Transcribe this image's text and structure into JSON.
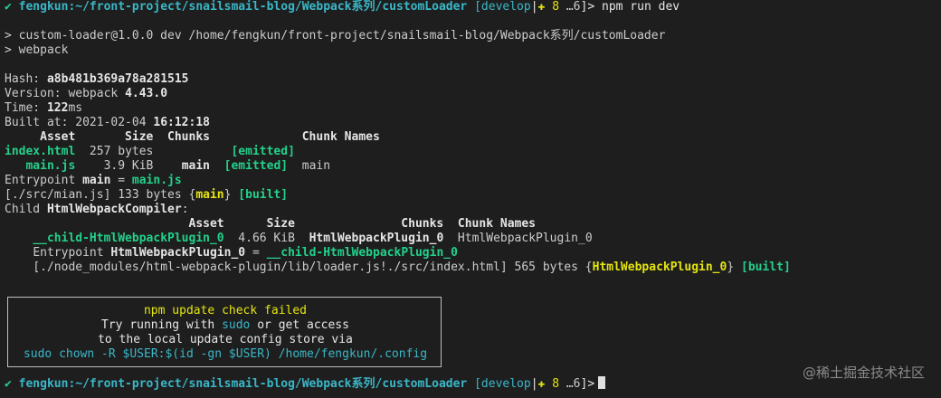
{
  "prompt": {
    "check": "✔",
    "path": "fengkun:~/front-project/snailsmail-blog/Webpack系列/customLoader",
    "branch_open": "[",
    "branch": "develop",
    "sep": "|",
    "plus": "✚ 8",
    "ellipsis": "…6",
    "close": "]>",
    "command": "npm run dev"
  },
  "script_header": {
    "line1": "> custom-loader@1.0.0 dev /home/fengkun/front-project/snailsmail-blog/Webpack系列/customLoader",
    "line2": "> webpack"
  },
  "build": {
    "hash_label": "Hash: ",
    "hash": "a8b481b369a78a281515",
    "version_label": "Version: webpack ",
    "version": "4.43.0",
    "time_label": "Time: ",
    "time": "122",
    "time_unit": "ms",
    "built_label": "Built at: 2021-02-04 ",
    "built_time": "16:12:18"
  },
  "assets_table": {
    "header": "     Asset       Size  Chunks             Chunk Names",
    "row1": {
      "name": "index.html",
      "size": "  257 bytes           ",
      "status": "[emitted]"
    },
    "row2": {
      "name": "main.js",
      "size": "    3.9 KiB    ",
      "chunk": "main",
      "status": "[emitted]",
      "names": "  main"
    }
  },
  "entrypoint": {
    "label": "Entrypoint ",
    "name": "main",
    "eq": " = ",
    "file": "main.js"
  },
  "module": {
    "path": "[./src/mian.js] 133 bytes {",
    "chunk": "main",
    "close": "} ",
    "status": "[built]"
  },
  "child": {
    "label": "Child ",
    "name": "HtmlWebpackCompiler",
    "colon": ":",
    "header": "                          Asset      Size               Chunks  Chunk Names",
    "asset": "__child-HtmlWebpackPlugin_0",
    "asset_size": "  4.66 KiB  ",
    "chunk": "HtmlWebpackPlugin_0",
    "chunk_name": "  HtmlWebpackPlugin_0",
    "entry_label": "Entrypoint ",
    "entry_name": "HtmlWebpackPlugin_0",
    "entry_eq": " = ",
    "entry_file": "__child-HtmlWebpackPlugin_0",
    "module_path": "[./node_modules/html-webpack-plugin/lib/loader.js!./src/index.html] 565 bytes {",
    "module_chunk": "HtmlWebpackPlugin_0",
    "module_close": "} ",
    "module_status": "[built]"
  },
  "update_box": {
    "title": "npm update check failed",
    "line2_pre": "Try running with ",
    "line2_sudo": "sudo",
    "line2_post": " or get access",
    "line3": "to the local update config store via",
    "line4": "sudo chown -R $USER:$(id -gn $USER) /home/fengkun/.config"
  },
  "watermark": "@稀土掘金技术社区",
  "colors": {
    "green": "#23d18b",
    "cyan": "#3ab7c8",
    "yellow": "#e5e510",
    "background": "#1e1e1e"
  }
}
